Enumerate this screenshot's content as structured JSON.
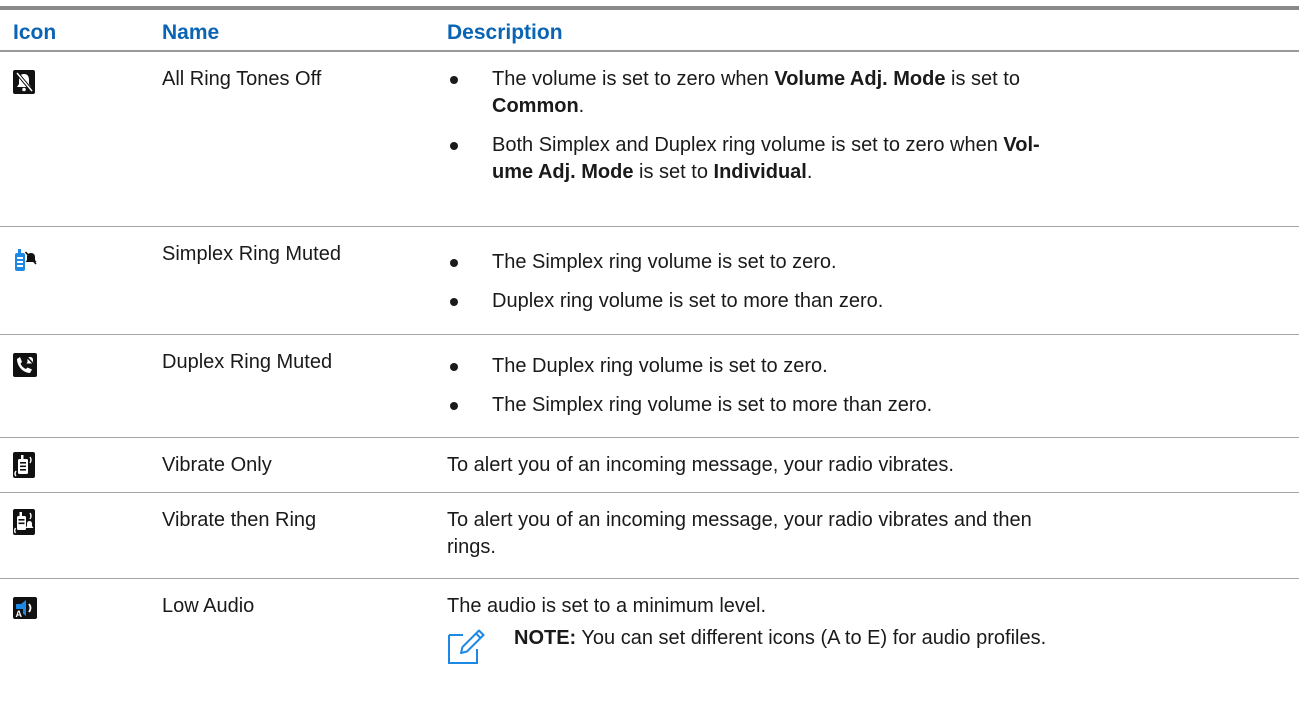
{
  "header": {
    "icon": "Icon",
    "name": "Name",
    "description": "Description"
  },
  "rows": [
    {
      "icon": "bell-off-icon",
      "name": "All Ring Tones Off",
      "bullets": [
        {
          "p1": "The volume is set to zero when ",
          "b1": "Volume Adj. Mode",
          "p2": " is set to ",
          "b2": "Common",
          "p3": "."
        },
        {
          "p1": "Both Simplex and Duplex ring volume is set to zero when ",
          "b1": "Vol-",
          "p2": "",
          "b2": "ume Adj. Mode",
          "p3": " is set to ",
          "b3": "Individual",
          "p4": "."
        }
      ]
    },
    {
      "icon": "simplex-ring-muted-icon",
      "name": "Simplex Ring Muted",
      "bullets": [
        {
          "text": "The Simplex ring volume is set to zero."
        },
        {
          "text": "Duplex ring volume is set to more than zero."
        }
      ]
    },
    {
      "icon": "duplex-ring-muted-icon",
      "name": "Duplex Ring Muted",
      "bullets": [
        {
          "text": "The Duplex ring volume is set to zero."
        },
        {
          "text": "The Simplex ring volume is set to more than zero."
        }
      ]
    },
    {
      "icon": "vibrate-only-icon",
      "name": "Vibrate Only",
      "description": "To alert you of an incoming message, your radio vibrates."
    },
    {
      "icon": "vibrate-then-ring-icon",
      "name": "Vibrate then Ring",
      "description_line1": "To alert you of an incoming message, your radio vibrates and then",
      "description_line2": "rings."
    },
    {
      "icon": "low-audio-icon",
      "name": "Low Audio",
      "description": "The audio is set to a minimum level.",
      "note_label": "NOTE:",
      "note_text": " You can set different icons (A to E) for audio profiles.",
      "note_icon": "note-pencil-icon"
    }
  ],
  "colors": {
    "header_text": "#0a64b4",
    "icon_blue": "#1e88e5",
    "rule": "#8a8a8a"
  }
}
